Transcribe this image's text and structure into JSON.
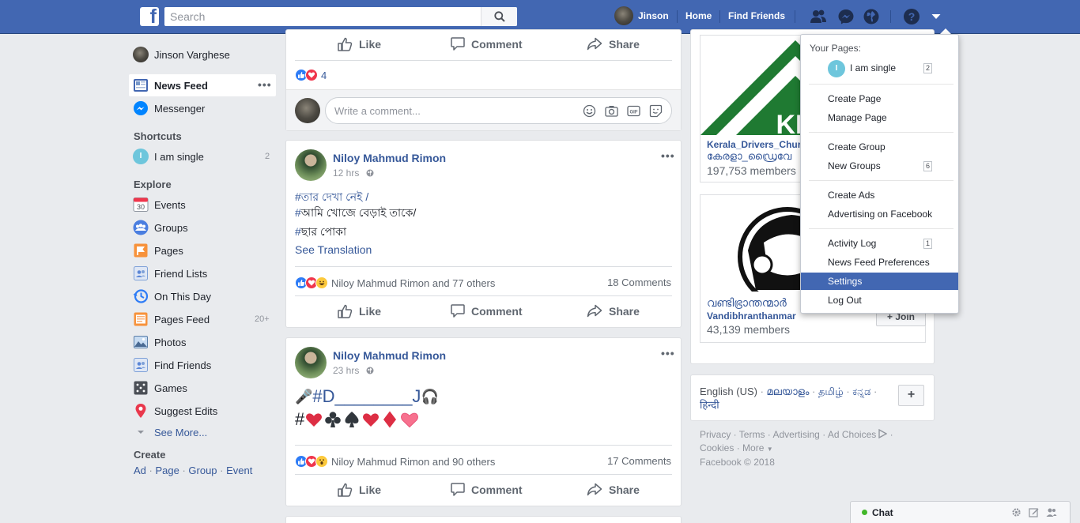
{
  "topbar": {
    "search_placeholder": "Search",
    "user_name": "Jinson",
    "home": "Home",
    "find_friends": "Find Friends"
  },
  "left": {
    "profile_name": "Jinson Varghese",
    "news_feed": "News Feed",
    "messenger": "Messenger",
    "shortcuts_title": "Shortcuts",
    "shortcut_item": "I am single",
    "shortcut_initial": "I",
    "shortcut_count": "2",
    "explore_title": "Explore",
    "explore": [
      {
        "label": "Events",
        "icon": "calendar-icon",
        "badge": "30"
      },
      {
        "label": "Groups",
        "icon": "groups-icon"
      },
      {
        "label": "Pages",
        "icon": "flag-icon"
      },
      {
        "label": "Friend Lists",
        "icon": "friend-list-icon"
      },
      {
        "label": "On This Day",
        "icon": "clock-icon"
      },
      {
        "label": "Pages Feed",
        "icon": "pages-feed-icon",
        "count": "20+"
      },
      {
        "label": "Photos",
        "icon": "photos-icon"
      },
      {
        "label": "Find Friends",
        "icon": "find-friends-icon"
      },
      {
        "label": "Games",
        "icon": "games-icon"
      },
      {
        "label": "Suggest Edits",
        "icon": "map-pin-icon"
      }
    ],
    "see_more": "See More...",
    "create_title": "Create",
    "create_links": [
      "Ad",
      "Page",
      "Group",
      "Event"
    ]
  },
  "feed": {
    "like": "Like",
    "comment": "Comment",
    "share": "Share",
    "top_reaction_count": "4",
    "comment_placeholder": "Write a comment...",
    "gif_label": "GIF",
    "posts": [
      {
        "author": "Niloy Mahmud Rimon",
        "time": "12 hrs",
        "lines": [
          {
            "tag": "#",
            "text": "তার দেখা নেই /"
          },
          {
            "tag": "#",
            "text": "আমি খোজে বেড়াই তাকে/"
          },
          {
            "tag": "#",
            "text": "ছার পোকা"
          }
        ],
        "translation": "See Translation",
        "reactions": "Niloy Mahmud Rimon and 77 others",
        "comments": "18 Comments"
      },
      {
        "author": "Niloy Mahmud Rimon",
        "time": "23 hrs",
        "line1_prefix": "🎤",
        "line1": "#D________J",
        "line1_suffix": "🎧",
        "line2": "#",
        "reactions": "Niloy Mahmud Rimon and 90 others",
        "comments": "17 Comments"
      }
    ]
  },
  "right": {
    "groups": [
      {
        "name": "Kerala_Drivers_Chur",
        "sub": "കേരളാ_ഡ്രൈവേ",
        "members": "197,753 members",
        "logo_text": "KD"
      },
      {
        "name": "Vandibhranthanmar",
        "sub": "വണ്ടിഭ്രാന്തന്മാർ",
        "members": "43,139 members",
        "join": "+ Join"
      }
    ],
    "languages": [
      "English (US)",
      "മലയാളം",
      "தமிழ்",
      "ಕನ್ನಡ",
      "हिन्दी"
    ],
    "add_language": "+",
    "footer": {
      "privacy": "Privacy",
      "terms": "Terms",
      "advertising": "Advertising",
      "ad_choices": "Ad Choices",
      "cookies": "Cookies",
      "more": "More",
      "copyright": "Facebook © 2018"
    }
  },
  "dropdown": {
    "your_pages": "Your Pages:",
    "page_name": "I am single",
    "page_initial": "I",
    "page_badge": "2",
    "create_page": "Create Page",
    "manage_page": "Manage Page",
    "create_group": "Create Group",
    "new_groups": "New Groups",
    "new_groups_badge": "6",
    "create_ads": "Create Ads",
    "advertising": "Advertising on Facebook",
    "activity_log": "Activity Log",
    "activity_badge": "1",
    "news_feed_prefs": "News Feed Preferences",
    "settings": "Settings",
    "log_out": "Log Out"
  },
  "chat": {
    "label": "Chat",
    "status_color": "#42b72a"
  },
  "colors": {
    "brand": "#4267b2",
    "link": "#365899",
    "background": "#e9ebee"
  }
}
